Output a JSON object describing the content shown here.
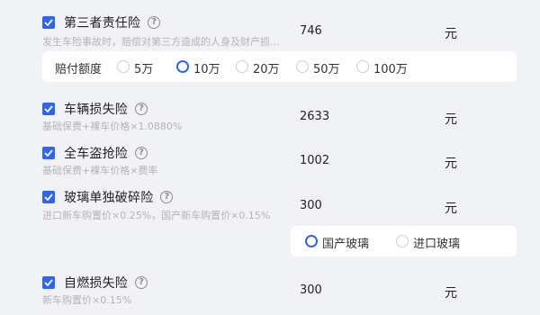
{
  "items": [
    {
      "title": "第三者责任险",
      "description": "发生车险事故时，赔偿对第三方造成的人身及财产损...",
      "value": "746",
      "unit": "元",
      "checked": true
    },
    {
      "title": "车辆损失险",
      "description": "基础保费+裸车价格×1.0880%",
      "value": "2633",
      "unit": "元",
      "checked": true
    },
    {
      "title": "全车盗抢险",
      "description": "基础保费+裸车价格×费率",
      "value": "1002",
      "unit": "元",
      "checked": true
    },
    {
      "title": "玻璃单独破碎险",
      "description": "进口新车购置价×0.25%，国产新车购置价×0.15%",
      "value": "300",
      "unit": "元",
      "checked": true
    },
    {
      "title": "自燃损失险",
      "description": "新车购置价×0.15%",
      "value": "300",
      "unit": "元",
      "checked": true
    }
  ],
  "compensation": {
    "label": "赔付额度",
    "options": [
      "5万",
      "10万",
      "20万",
      "50万",
      "100万"
    ],
    "selected": "10万"
  },
  "glass_type": {
    "options": [
      "国产玻璃",
      "进口玻璃"
    ],
    "selected": "国产玻璃"
  },
  "help_glyph": "?",
  "colors": {
    "accent": "#2f64f0",
    "background": "#f1f2f5",
    "panel": "#ffffff",
    "muted_text": "#b4b4b4"
  },
  "icons": {
    "checkbox": "checkbox-checked-icon",
    "help": "question-circle-icon",
    "radio": "radio-icon"
  }
}
